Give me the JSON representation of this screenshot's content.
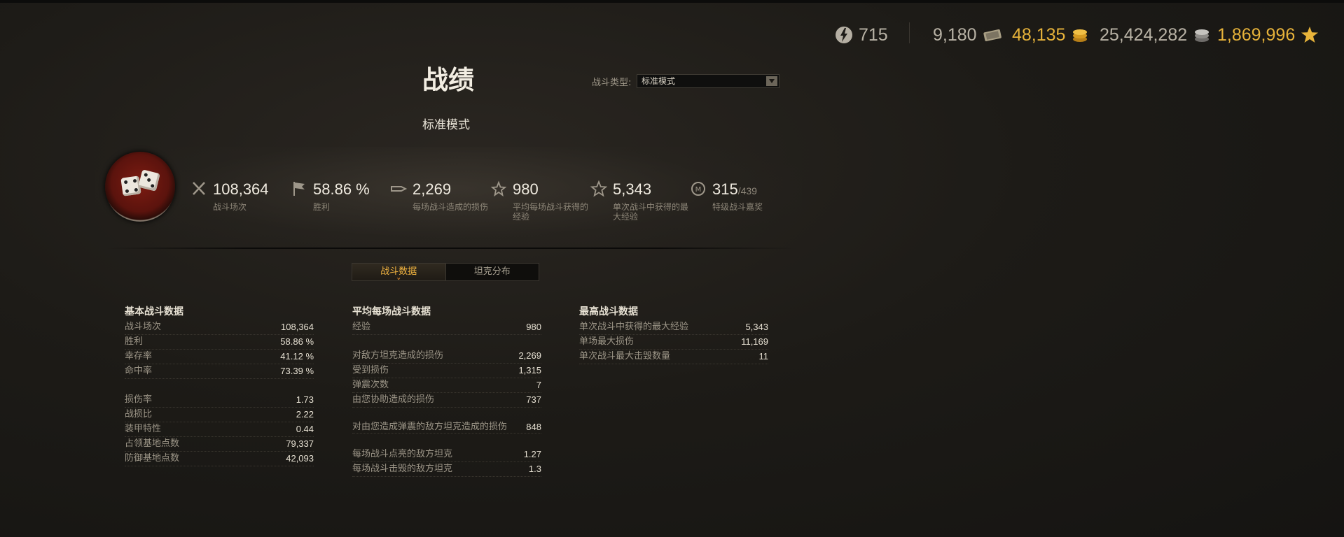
{
  "currency": {
    "free_xp": "715",
    "bonds": "9,180",
    "gold": "48,135",
    "credits": "25,424,282",
    "crew_xp": "1,869,996",
    "colors": {
      "gold": "#e6b23a",
      "default": "#b8b2a5",
      "star": "#e8b43a"
    }
  },
  "header": {
    "title": "战绩",
    "subtitle": "标准模式",
    "battle_type_label": "战斗类型:",
    "battle_type_value": "标准模式"
  },
  "summary": [
    {
      "icon": "crossed-swords-icon",
      "value": "108,364",
      "label": "战斗场次"
    },
    {
      "icon": "flag-icon",
      "value": "58.86 %",
      "label": "胜利"
    },
    {
      "icon": "shell-icon",
      "value": "2,269",
      "label": "每场战斗造成的损伤"
    },
    {
      "icon": "star-wings-icon",
      "value": "980",
      "label": "平均每场战斗获得的经验"
    },
    {
      "icon": "star-outline-icon",
      "value": "5,343",
      "label": "单次战斗中获得的最大经验"
    },
    {
      "icon": "mastery-badge-icon",
      "value": "315",
      "value_total": "/439",
      "label": "特级战斗嘉奖"
    }
  ],
  "tabs": [
    "战斗数据",
    "坦克分布"
  ],
  "basic": {
    "title": "基本战斗数据",
    "rows": [
      {
        "k": "战斗场次",
        "v": "108,364"
      },
      {
        "k": "胜利",
        "v": "58.86 %"
      },
      {
        "k": "幸存率",
        "v": "41.12 %"
      },
      {
        "k": "命中率",
        "v": "73.39 %"
      },
      {
        "k": "损伤率",
        "v": "1.73"
      },
      {
        "k": "战损比",
        "v": "2.22"
      },
      {
        "k": "装甲特性",
        "v": "0.44"
      },
      {
        "k": "占领基地点数",
        "v": "79,337"
      },
      {
        "k": "防御基地点数",
        "v": "42,093"
      }
    ]
  },
  "average": {
    "title": "平均每场战斗数据",
    "rows": [
      {
        "k": "经验",
        "v": "980"
      },
      {
        "k": "对敌方坦克造成的损伤",
        "v": "2,269"
      },
      {
        "k": "受到损伤",
        "v": "1,315"
      },
      {
        "k": "弹震次数",
        "v": "7"
      },
      {
        "k": "由您协助造成的损伤",
        "v": "737"
      },
      {
        "k": "对由您造成弹震的敌方坦克造成的损伤",
        "v": "848"
      },
      {
        "k": "每场战斗点亮的敌方坦克",
        "v": "1.27"
      },
      {
        "k": "每场战斗击毁的敌方坦克",
        "v": "1.3"
      }
    ]
  },
  "best": {
    "title": "最高战斗数据",
    "rows": [
      {
        "k": "单次战斗中获得的最大经验",
        "v": "5,343"
      },
      {
        "k": "单场最大损伤",
        "v": "11,169"
      },
      {
        "k": "单次战斗最大击毁数量",
        "v": "11"
      }
    ]
  }
}
